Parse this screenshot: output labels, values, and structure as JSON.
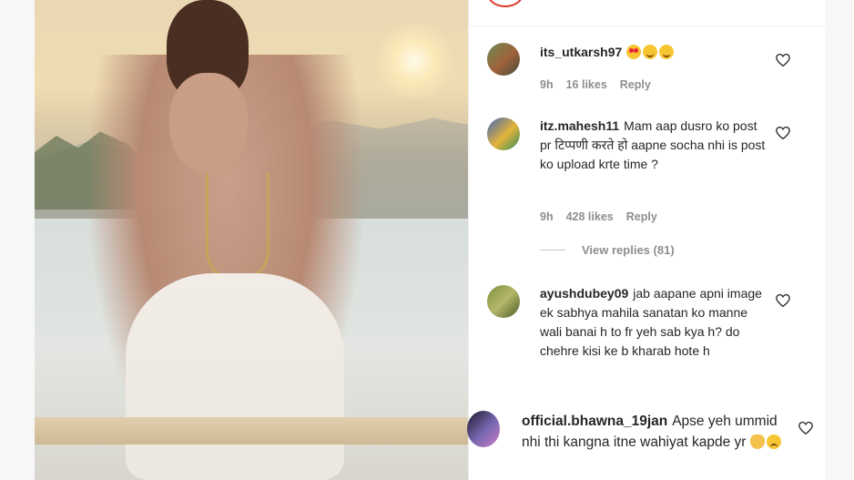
{
  "comments": [
    {
      "username": "its_utkarsh97",
      "text": "",
      "emojis": [
        "heart-eyes",
        "smile",
        "smile"
      ],
      "time": "9h",
      "likes": "16 likes",
      "reply": "Reply"
    },
    {
      "username": "itz.mahesh11",
      "text": "Mam aap dusro ko post pr टिप्पणी करते हो aapne socha nhi is post ko upload krte time ?",
      "time": "9h",
      "likes": "428 likes",
      "reply": "Reply",
      "view_replies": "View replies (81)"
    },
    {
      "username": "ayushdubey09",
      "text": "jab aapane apni image ek sabhya mahila sanatan ko manne wali banai h to fr yeh sab kya h? do chehre kisi ke b kharab hote h"
    },
    {
      "username": "official.bhawna_19jan",
      "text": "Apse yeh ummid nhi thi kangna itne wahiyat kapde yr",
      "emojis": [
        "clap",
        "sad"
      ]
    }
  ],
  "colors": {
    "text": "#262626",
    "meta": "#8e8e8e",
    "story_ring": "#d93b2b"
  },
  "icons": {
    "like": "heart-outline-icon"
  }
}
